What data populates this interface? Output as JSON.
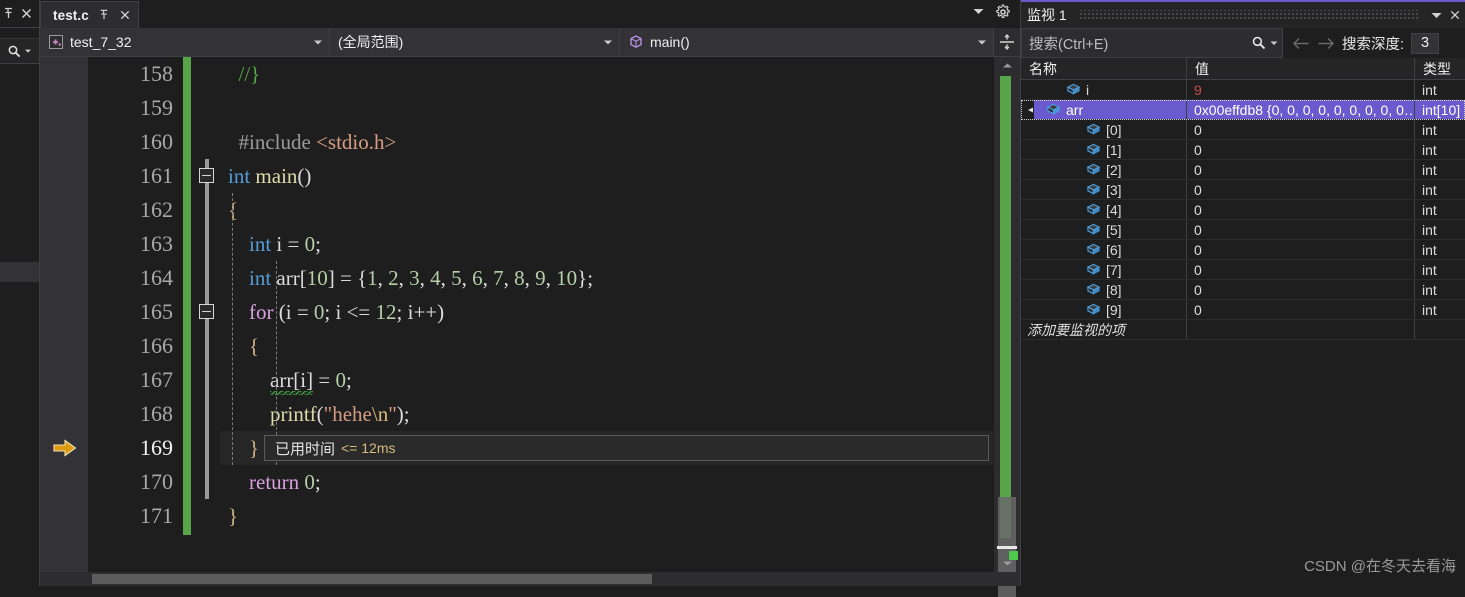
{
  "left_dock": {
    "pin_icon": "pin-icon",
    "close_icon": "close-icon",
    "search_icon": "search-icon",
    "caret_icon": "chevron-down-icon"
  },
  "tabs": [
    {
      "label": "test.c",
      "pin_icon": "pin-icon",
      "close_icon": "close-icon",
      "active": true
    }
  ],
  "tabstrip": {
    "overflow_caret": "chevron-down-icon",
    "settings_icon": "gear-icon"
  },
  "navbar": {
    "project": "test_7_32",
    "project_icon": "cpp-project-icon",
    "scope": "(全局范围)",
    "member": "main()",
    "member_icon": "method-cube-icon",
    "split_icon": "split-window-icon",
    "caret": "▾"
  },
  "editor": {
    "first_line": 158,
    "current_line": 169,
    "lines": [
      {
        "n": 158,
        "tokens": [
          {
            "t": "  ",
            "c": "t-plain"
          },
          {
            "t": "//}",
            "c": "t-cmt"
          }
        ]
      },
      {
        "n": 159,
        "tokens": []
      },
      {
        "n": 160,
        "tokens": [
          {
            "t": "  ",
            "c": "t-plain"
          },
          {
            "t": "#include",
            "c": "t-pp"
          },
          {
            "t": " ",
            "c": "t-plain"
          },
          {
            "t": "<stdio.h>",
            "c": "t-inc"
          }
        ]
      },
      {
        "n": 161,
        "tokens": [
          {
            "t": "int",
            "c": "t-kw"
          },
          {
            "t": " ",
            "c": "t-plain"
          },
          {
            "t": "main",
            "c": "t-fn"
          },
          {
            "t": "()",
            "c": "t-punct"
          }
        ]
      },
      {
        "n": 162,
        "tokens": [
          {
            "t": "{",
            "c": "t-brace"
          }
        ]
      },
      {
        "n": 163,
        "tokens": [
          {
            "t": "    ",
            "c": "t-plain"
          },
          {
            "t": "int",
            "c": "t-kw"
          },
          {
            "t": " i = ",
            "c": "t-plain"
          },
          {
            "t": "0",
            "c": "t-num"
          },
          {
            "t": ";",
            "c": "t-punct"
          }
        ]
      },
      {
        "n": 164,
        "tokens": [
          {
            "t": "    ",
            "c": "t-plain"
          },
          {
            "t": "int",
            "c": "t-kw"
          },
          {
            "t": " arr[",
            "c": "t-plain"
          },
          {
            "t": "10",
            "c": "t-num"
          },
          {
            "t": "] = {",
            "c": "t-plain"
          },
          {
            "t": "1",
            "c": "t-num"
          },
          {
            "t": ", ",
            "c": "t-punct"
          },
          {
            "t": "2",
            "c": "t-num"
          },
          {
            "t": ", ",
            "c": "t-punct"
          },
          {
            "t": "3",
            "c": "t-num"
          },
          {
            "t": ", ",
            "c": "t-punct"
          },
          {
            "t": "4",
            "c": "t-num"
          },
          {
            "t": ", ",
            "c": "t-punct"
          },
          {
            "t": "5",
            "c": "t-num"
          },
          {
            "t": ", ",
            "c": "t-punct"
          },
          {
            "t": "6",
            "c": "t-num"
          },
          {
            "t": ", ",
            "c": "t-punct"
          },
          {
            "t": "7",
            "c": "t-num"
          },
          {
            "t": ", ",
            "c": "t-punct"
          },
          {
            "t": "8",
            "c": "t-num"
          },
          {
            "t": ", ",
            "c": "t-punct"
          },
          {
            "t": "9",
            "c": "t-num"
          },
          {
            "t": ", ",
            "c": "t-punct"
          },
          {
            "t": "10",
            "c": "t-num"
          },
          {
            "t": "};",
            "c": "t-punct"
          }
        ]
      },
      {
        "n": 165,
        "tokens": [
          {
            "t": "    ",
            "c": "t-plain"
          },
          {
            "t": "for",
            "c": "t-ctrl"
          },
          {
            "t": " (i = ",
            "c": "t-plain"
          },
          {
            "t": "0",
            "c": "t-num"
          },
          {
            "t": "; i <= ",
            "c": "t-plain"
          },
          {
            "t": "12",
            "c": "t-num"
          },
          {
            "t": "; i++)",
            "c": "t-plain"
          }
        ]
      },
      {
        "n": 166,
        "tokens": [
          {
            "t": "    ",
            "c": "t-plain"
          },
          {
            "t": "{",
            "c": "t-brace"
          }
        ]
      },
      {
        "n": 167,
        "tokens": [
          {
            "t": "        ",
            "c": "t-plain"
          },
          {
            "t": "arr[i]",
            "c": "t-plain squiggle"
          },
          {
            "t": " = ",
            "c": "t-plain"
          },
          {
            "t": "0",
            "c": "t-num"
          },
          {
            "t": ";",
            "c": "t-punct"
          }
        ]
      },
      {
        "n": 168,
        "tokens": [
          {
            "t": "        ",
            "c": "t-plain"
          },
          {
            "t": "printf",
            "c": "t-fn"
          },
          {
            "t": "(",
            "c": "t-punct"
          },
          {
            "t": "\"hehe",
            "c": "t-str"
          },
          {
            "t": "\\n",
            "c": "t-esc"
          },
          {
            "t": "\"",
            "c": "t-str"
          },
          {
            "t": ");",
            "c": "t-punct"
          }
        ]
      },
      {
        "n": 169,
        "tokens": [
          {
            "t": "    ",
            "c": "t-plain"
          },
          {
            "t": "}",
            "c": "t-brace"
          }
        ]
      },
      {
        "n": 170,
        "tokens": [
          {
            "t": "    ",
            "c": "t-plain"
          },
          {
            "t": "return",
            "c": "t-ctrl"
          },
          {
            "t": " ",
            "c": "t-plain"
          },
          {
            "t": "0",
            "c": "t-num"
          },
          {
            "t": ";",
            "c": "t-punct"
          }
        ]
      },
      {
        "n": 171,
        "tokens": [
          {
            "t": "}",
            "c": "t-brace"
          }
        ]
      }
    ],
    "perftip": {
      "label": "已用时间",
      "value": "<= 12ms"
    },
    "current_statement_icon": "current-execution-arrow-icon"
  },
  "watch": {
    "title": "监视 1",
    "title_caret": "chevron-down-icon",
    "title_close": "close-icon",
    "search": {
      "placeholder": "搜索(Ctrl+E)",
      "search_icon": "search-icon",
      "dropdown_icon": "chevron-down-icon"
    },
    "prev_icon": "arrow-left-icon",
    "next_icon": "arrow-right-icon",
    "depth_label": "搜索深度:",
    "depth_value": "3",
    "columns": [
      "名称",
      "值",
      "类型"
    ],
    "rows": [
      {
        "indent": 1,
        "expander": "",
        "icon": "variable-cube-icon",
        "name": "i",
        "value": "9",
        "type": "int",
        "selected": false,
        "value_changed": true
      },
      {
        "indent": 0,
        "expander": "▾",
        "icon": "variable-cube-icon",
        "name": "arr",
        "value": "0x00effdb8 {0, 0, 0, 0, 0, 0, 0, 0, 0…",
        "type": "int[10]",
        "selected": true,
        "value_changed": false
      },
      {
        "indent": 2,
        "expander": "",
        "icon": "variable-cube-icon",
        "name": "[0]",
        "value": "0",
        "type": "int",
        "selected": false,
        "value_changed": false
      },
      {
        "indent": 2,
        "expander": "",
        "icon": "variable-cube-icon",
        "name": "[1]",
        "value": "0",
        "type": "int",
        "selected": false,
        "value_changed": false
      },
      {
        "indent": 2,
        "expander": "",
        "icon": "variable-cube-icon",
        "name": "[2]",
        "value": "0",
        "type": "int",
        "selected": false,
        "value_changed": false
      },
      {
        "indent": 2,
        "expander": "",
        "icon": "variable-cube-icon",
        "name": "[3]",
        "value": "0",
        "type": "int",
        "selected": false,
        "value_changed": false
      },
      {
        "indent": 2,
        "expander": "",
        "icon": "variable-cube-icon",
        "name": "[4]",
        "value": "0",
        "type": "int",
        "selected": false,
        "value_changed": false
      },
      {
        "indent": 2,
        "expander": "",
        "icon": "variable-cube-icon",
        "name": "[5]",
        "value": "0",
        "type": "int",
        "selected": false,
        "value_changed": false
      },
      {
        "indent": 2,
        "expander": "",
        "icon": "variable-cube-icon",
        "name": "[6]",
        "value": "0",
        "type": "int",
        "selected": false,
        "value_changed": false
      },
      {
        "indent": 2,
        "expander": "",
        "icon": "variable-cube-icon",
        "name": "[7]",
        "value": "0",
        "type": "int",
        "selected": false,
        "value_changed": false
      },
      {
        "indent": 2,
        "expander": "",
        "icon": "variable-cube-icon",
        "name": "[8]",
        "value": "0",
        "type": "int",
        "selected": false,
        "value_changed": false
      },
      {
        "indent": 2,
        "expander": "",
        "icon": "variable-cube-icon",
        "name": "[9]",
        "value": "0",
        "type": "int",
        "selected": false,
        "value_changed": false
      }
    ],
    "add_row_label": "添加要监视的项"
  },
  "watermark": "CSDN @在冬天去看海",
  "colors": {
    "background": "#1e1e1e",
    "chrome": "#2d2d30",
    "selection": "#6a5acd",
    "change_bar": "#57a64a",
    "accent_title": "#6a5acd",
    "current_arrow": "#dd9b11",
    "comment": "#57a64a",
    "keyword": "#569cd6",
    "control_keyword": "#d8a0df",
    "number": "#b5cea8",
    "string": "#d69d85",
    "function": "#dcdcaa",
    "value_changed": "#c0504d"
  }
}
